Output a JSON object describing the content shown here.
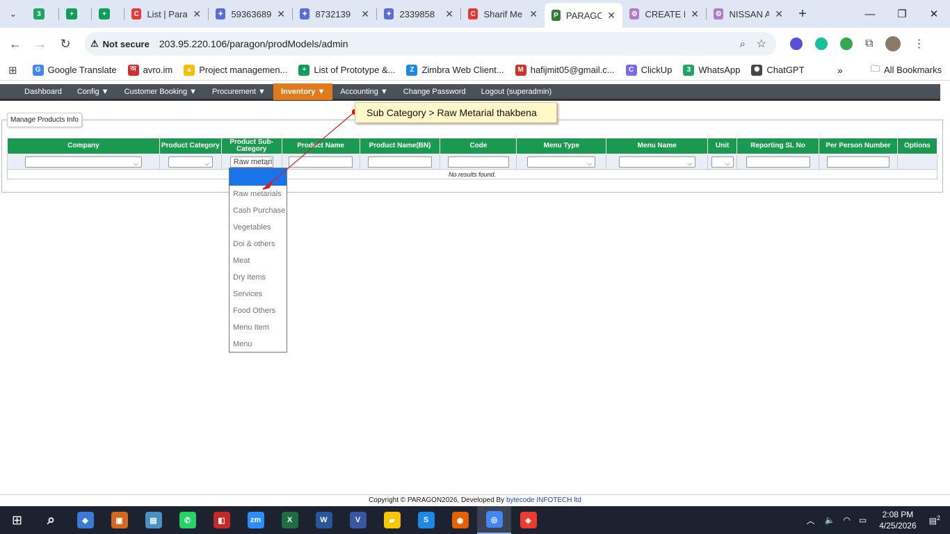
{
  "browser": {
    "tabs": [
      {
        "title": "",
        "color": "#1fa463",
        "glyph": "3"
      },
      {
        "title": "",
        "color": "#0f9d58",
        "glyph": "+"
      },
      {
        "title": "",
        "color": "#0f9d58",
        "glyph": "+"
      },
      {
        "title": "List | Para",
        "color": "#e53935",
        "glyph": "C"
      },
      {
        "title": "59363689",
        "color": "#5b6cd8",
        "glyph": "✦"
      },
      {
        "title": "8732139",
        "color": "#5b6cd8",
        "glyph": "✦"
      },
      {
        "title": "2339858",
        "color": "#5b6cd8",
        "glyph": "✦"
      },
      {
        "title": "Sharif Me",
        "color": "#e53935",
        "glyph": "C"
      },
      {
        "title": "PARAGON",
        "color": "#2e7d32",
        "glyph": "P"
      },
      {
        "title": "CREATE N",
        "color": "#b07cc6",
        "glyph": "⚙"
      },
      {
        "title": "NISSAN A",
        "color": "#b07cc6",
        "glyph": "⚙"
      }
    ],
    "security_label": "Not secure",
    "url": "203.95.220.106/paragon/prodModels/admin",
    "bookmarks": [
      {
        "label": "Google Translate",
        "color": "#4285f4",
        "glyph": "G"
      },
      {
        "label": "avro.im",
        "color": "#d32f2f",
        "glyph": "অ"
      },
      {
        "label": "Project managemen...",
        "color": "#fbbc04",
        "glyph": "▲"
      },
      {
        "label": "List of Prototype &...",
        "color": "#0f9d58",
        "glyph": "+"
      },
      {
        "label": "Zimbra Web Client...",
        "color": "#1e88e5",
        "glyph": "Z"
      },
      {
        "label": "hafijmit05@gmail.c...",
        "color": "#d93025",
        "glyph": "M"
      },
      {
        "label": "ClickUp",
        "color": "#7b68ee",
        "glyph": "C"
      },
      {
        "label": "WhatsApp",
        "color": "#1fa463",
        "glyph": "3"
      },
      {
        "label": "ChatGPT",
        "color": "#444444",
        "glyph": "✺"
      }
    ],
    "all_bookmarks": "All Bookmarks"
  },
  "nav": {
    "items": [
      "Dashboard",
      "Config ▼",
      "Customer Booking ▼",
      "Procurement ▼",
      "Inventory ▼",
      "Accounting ▼",
      "Change Password",
      "Logout (superadmin)"
    ],
    "active_index": 4
  },
  "panel": {
    "legend": "Manage Products Info"
  },
  "grid": {
    "columns": [
      "Company",
      "Product Category",
      "Product Sub-Category",
      "Product Name",
      "Product Name(BN)",
      "Code",
      "Menu Type",
      "Menu Name",
      "Unit",
      "Reporting SL No",
      "Per Person Number",
      "Options"
    ],
    "subcategory_value": "Raw metari",
    "empty_text": "No results found."
  },
  "dropdown": {
    "options": [
      "",
      "Raw metarials",
      "Cash Purchase",
      "Vegetables",
      "Doi & others",
      "Meat",
      "Dry Items",
      "Services",
      "Food Others",
      "Menu Item",
      "Menu"
    ]
  },
  "annotation": {
    "text": "Sub Category > Raw Metarial thakbena"
  },
  "footer": {
    "copyright": "Copyright © PARAGON2026, Developed By ",
    "developer": "bytecode INFOTECH ltd"
  },
  "taskbar": {
    "apps": [
      {
        "name": "search",
        "color": "#1c2230",
        "glyph": "⌕"
      },
      {
        "name": "copilot",
        "color": "#3a7bd5",
        "glyph": "◆"
      },
      {
        "name": "app-orange",
        "color": "#d2691e",
        "glyph": "▣"
      },
      {
        "name": "app-blue",
        "color": "#4a90c2",
        "glyph": "▤"
      },
      {
        "name": "whatsapp",
        "color": "#25d366",
        "glyph": "✆"
      },
      {
        "name": "app-red",
        "color": "#c62828",
        "glyph": "◧"
      },
      {
        "name": "zoom",
        "color": "#2d8cff",
        "glyph": "zm"
      },
      {
        "name": "excel",
        "color": "#1d6f42",
        "glyph": "X"
      },
      {
        "name": "word",
        "color": "#2b579a",
        "glyph": "W"
      },
      {
        "name": "visio",
        "color": "#3955a3",
        "glyph": "V"
      },
      {
        "name": "sticky",
        "color": "#f7c600",
        "glyph": "▰"
      },
      {
        "name": "app-s",
        "color": "#1e88e5",
        "glyph": "S"
      },
      {
        "name": "firefox",
        "color": "#e66000",
        "glyph": "◉"
      },
      {
        "name": "chrome",
        "color": "#4285f4",
        "glyph": "◎"
      },
      {
        "name": "anydesk",
        "color": "#ef3b2d",
        "glyph": "◈"
      }
    ],
    "time": "2:08 PM",
    "date": "4/25/2026",
    "notifications": "2"
  }
}
